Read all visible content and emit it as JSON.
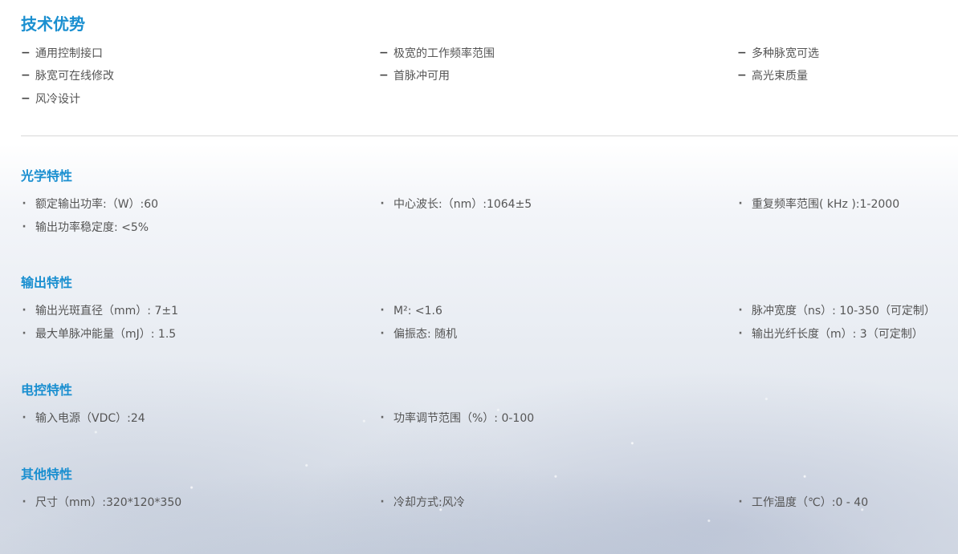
{
  "advantages": {
    "title": "技术优势",
    "items": [
      "通用控制接口",
      "极宽的工作频率范围",
      "多种脉宽可选",
      "脉宽可在线修改",
      "首脉冲可用",
      "高光束质量",
      "风冷设计"
    ]
  },
  "sections": [
    {
      "title": "光学特性",
      "rows": [
        [
          "额定输出功率:（W）:60",
          "中心波长:（nm）:1064±5",
          "重复频率范围( kHz ):1-2000"
        ],
        [
          "输出功率稳定度: <5%",
          "",
          ""
        ]
      ]
    },
    {
      "title": "输出特性",
      "rows": [
        [
          "输出光斑直径（mm）: 7±1",
          "M²: <1.6",
          "脉冲宽度（ns）: 10-350（可定制）"
        ],
        [
          "最大单脉冲能量（mJ）: 1.5",
          "偏振态: 随机",
          "输出光纤长度（m）: 3（可定制）"
        ]
      ]
    },
    {
      "title": "电控特性",
      "rows": [
        [
          "输入电源（VDC）:24",
          "功率调节范围（%）: 0-100",
          ""
        ]
      ]
    },
    {
      "title": "其他特性",
      "rows": [
        [
          "尺寸（mm）:320*120*350",
          "冷却方式:风冷",
          "工作温度（℃）:0 - 40"
        ]
      ]
    }
  ],
  "colors": {
    "accent": "#1a8fd0",
    "text": "#555555",
    "separator": "#d7d7d7"
  }
}
